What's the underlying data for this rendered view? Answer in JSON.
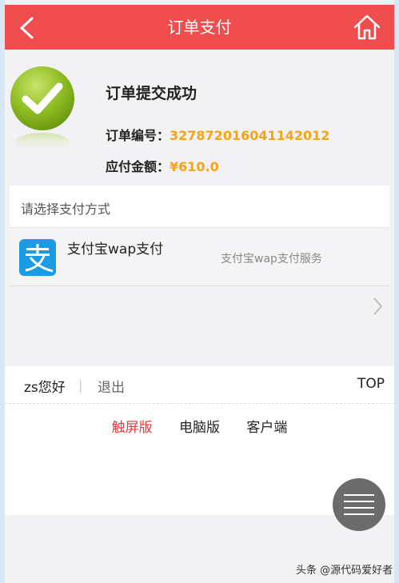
{
  "header": {
    "title": "订单支付"
  },
  "order": {
    "title": "订单提交成功",
    "number_label": "订单编号：",
    "number_value": "327872016041142012",
    "amount_label": "应付金额：",
    "amount_value": "¥610.0"
  },
  "payment": {
    "header": "请选择支付方式",
    "method_name": "支付宝wap支付",
    "method_desc": "支付宝wap支付服务"
  },
  "footer": {
    "user": "zs您好",
    "separator": "|",
    "logout": "退出",
    "top": "TOP",
    "versions": [
      "触屏版",
      "电脑版",
      "客户端"
    ]
  },
  "watermark": "头条 @源代码爱好者",
  "colors": {
    "accent": "#f04e4e",
    "amount": "#f5a317",
    "alipay": "#1a9be6"
  }
}
